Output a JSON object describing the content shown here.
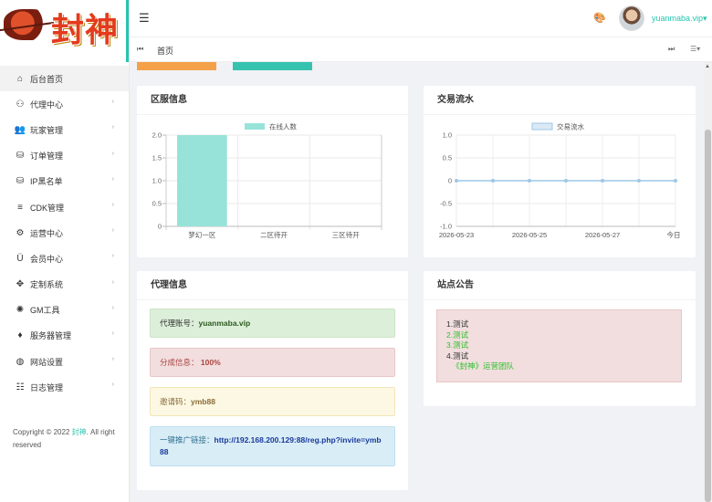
{
  "app": {
    "brand": "封神",
    "username": "yuanmaba.vip▾"
  },
  "sidebar": {
    "items": [
      {
        "label": "后台首页",
        "icon": "home-icon",
        "glyph": "⌂",
        "active": true,
        "arrow": ""
      },
      {
        "label": "代理中心",
        "icon": "users-icon",
        "glyph": "⚇",
        "arrow": "›"
      },
      {
        "label": "玩家管理",
        "icon": "group-icon",
        "glyph": "👥",
        "arrow": "›"
      },
      {
        "label": "订单管理",
        "icon": "database-icon",
        "glyph": "⛁",
        "arrow": "›"
      },
      {
        "label": "IP黑名单",
        "icon": "database-icon",
        "glyph": "⛁",
        "arrow": "›"
      },
      {
        "label": "CDK管理",
        "icon": "list-icon",
        "glyph": "≡",
        "arrow": "›"
      },
      {
        "label": "运营中心",
        "icon": "gear-icon",
        "glyph": "⚙",
        "arrow": "›"
      },
      {
        "label": "会员中心",
        "icon": "magnet-icon",
        "glyph": "Ü",
        "arrow": "›"
      },
      {
        "label": "定制系统",
        "icon": "puzzle-icon",
        "glyph": "✥",
        "arrow": "›"
      },
      {
        "label": "GM工具",
        "icon": "bulb-icon",
        "glyph": "✺",
        "arrow": "›"
      },
      {
        "label": "服务器管理",
        "icon": "diamond-icon",
        "glyph": "♦",
        "arrow": "›"
      },
      {
        "label": "网站设置",
        "icon": "globe-icon",
        "glyph": "◍",
        "arrow": "›"
      },
      {
        "label": "日志管理",
        "icon": "message-icon",
        "glyph": "☷",
        "arrow": "›"
      }
    ],
    "copyright_prefix": "Copyright © 2022 ",
    "copyright_brand": "封神",
    "copyright_suffix": ". All right reserved"
  },
  "tabs": {
    "prev": "⏮",
    "home": "首页",
    "next": "⏭",
    "more": "☰▾"
  },
  "cards": {
    "server_title": "区服信息",
    "trade_title": "交易流水",
    "agent_title": "代理信息",
    "notice_title": "站点公告"
  },
  "agent": {
    "account_label": "代理账号：",
    "account_value": "yuanmaba.vip",
    "share_label": "分成信息：",
    "share_value": "100%",
    "invite_label": "邀请码：",
    "invite_value": "ymb88",
    "link_label": "一键推广链接：",
    "link_value": "http://192.168.200.129:88/reg.php?invite=ymb88"
  },
  "notice": {
    "lines": [
      "1.测试",
      "2.测试",
      "3.测试",
      "4.测试"
    ],
    "team": "《封神》运营团队"
  },
  "colors": {
    "accent": "#27c4b0",
    "bar": "#97e3d9",
    "line": "#9ec7e6"
  },
  "chart_data": [
    {
      "type": "bar",
      "categories": [
        "梦幻一区",
        "二区待开",
        "三区待开"
      ],
      "series": [
        {
          "name": "在线人数",
          "values": [
            2,
            0,
            0
          ]
        }
      ],
      "ylim": [
        0,
        2
      ],
      "yticks": [
        "0",
        "0.5",
        "1.0",
        "1.5",
        "2.0"
      ],
      "grid": true,
      "legend": "top-center"
    },
    {
      "type": "line",
      "x": [
        "2026-05-23",
        "2026-05-24",
        "2026-05-25",
        "2026-05-26",
        "2026-05-27",
        "2026-05-28",
        "今日"
      ],
      "xticks": [
        "2026-05-23",
        "2026-05-25",
        "2026-05-27",
        "今日"
      ],
      "series": [
        {
          "name": "交易流水",
          "values": [
            0,
            0,
            0,
            0,
            0,
            0,
            0
          ]
        }
      ],
      "ylim": [
        -1,
        1
      ],
      "yticks": [
        "-1.0",
        "-0.5",
        "0",
        "0.5",
        "1.0"
      ],
      "grid": true,
      "legend": "top-center"
    }
  ]
}
